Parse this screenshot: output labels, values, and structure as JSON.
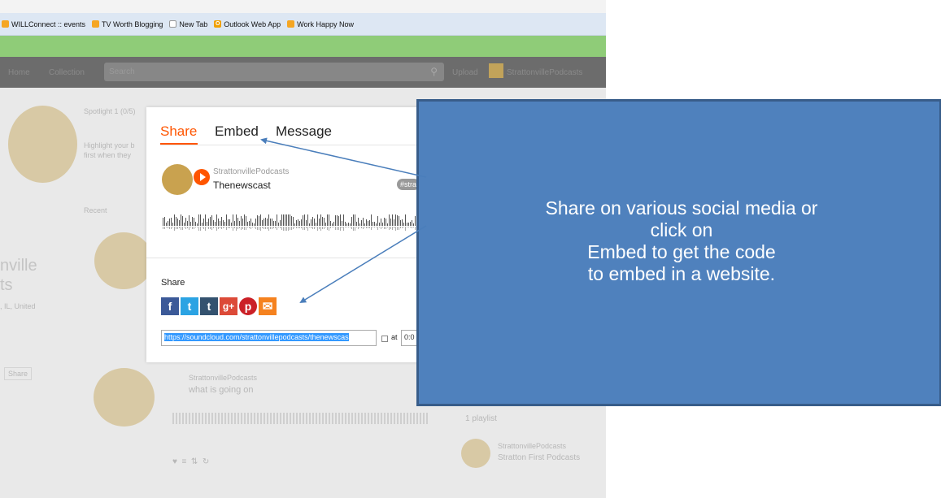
{
  "bookmarks": [
    {
      "label": "WILLConnect :: events",
      "icon": "rss-icon"
    },
    {
      "label": "TV Worth Blogging",
      "icon": "rss-icon"
    },
    {
      "label": "New Tab",
      "icon": "page-icon"
    },
    {
      "label": "Outlook Web App",
      "icon": "outlook-icon"
    },
    {
      "label": "Work Happy Now",
      "icon": "rss-icon"
    }
  ],
  "nav": {
    "home": "Home",
    "collection": "Collection",
    "search_placeholder": "Search",
    "upload": "Upload",
    "username": "StrattonvillePodcasts"
  },
  "background": {
    "spotlight": "Spotlight 1 (0/5)",
    "spotlight_desc1": "Highlight your b",
    "spotlight_desc2": "first when they",
    "recent": "Recent",
    "profile_name1": "nville",
    "profile_name2": "ts",
    "profile_loc": ", IL, United",
    "share_btn": "Share",
    "second_track_user": "StrattonvillePodcasts",
    "second_track_title": "what is going on",
    "playlist_count": "1 playlist",
    "playlist_user": "StrattonvillePodcasts",
    "playlist_title": "Stratton First Podcasts"
  },
  "modal": {
    "tabs": {
      "share": "Share",
      "embed": "Embed",
      "message": "Message"
    },
    "track": {
      "user": "StrattonvillePodcasts",
      "title": "Thenewscast",
      "tag": "#stra"
    },
    "share_label": "Share",
    "social_buttons": [
      {
        "label": "f",
        "icon": "facebook-icon"
      },
      {
        "label": "t",
        "icon": "twitter-icon"
      },
      {
        "label": "t",
        "icon": "tumblr-icon"
      },
      {
        "label": "g+",
        "icon": "google-plus-icon"
      },
      {
        "label": "p",
        "icon": "pinterest-icon"
      },
      {
        "label": "✉",
        "icon": "email-icon"
      }
    ],
    "url": "https://soundcloud.com/strattonvillepodcasts/thenewscas",
    "at_label": "at",
    "time": "0:0"
  },
  "callout": {
    "lines": [
      "Share on various social media or",
      "click on",
      "Embed to get the code",
      "to embed in a website."
    ],
    "colors": {
      "fill": "#4f81bd",
      "border": "#385d8a",
      "text": "#ffffff"
    }
  },
  "colors": {
    "accent": "#ff5500",
    "arrow": "#4a7ebb"
  }
}
